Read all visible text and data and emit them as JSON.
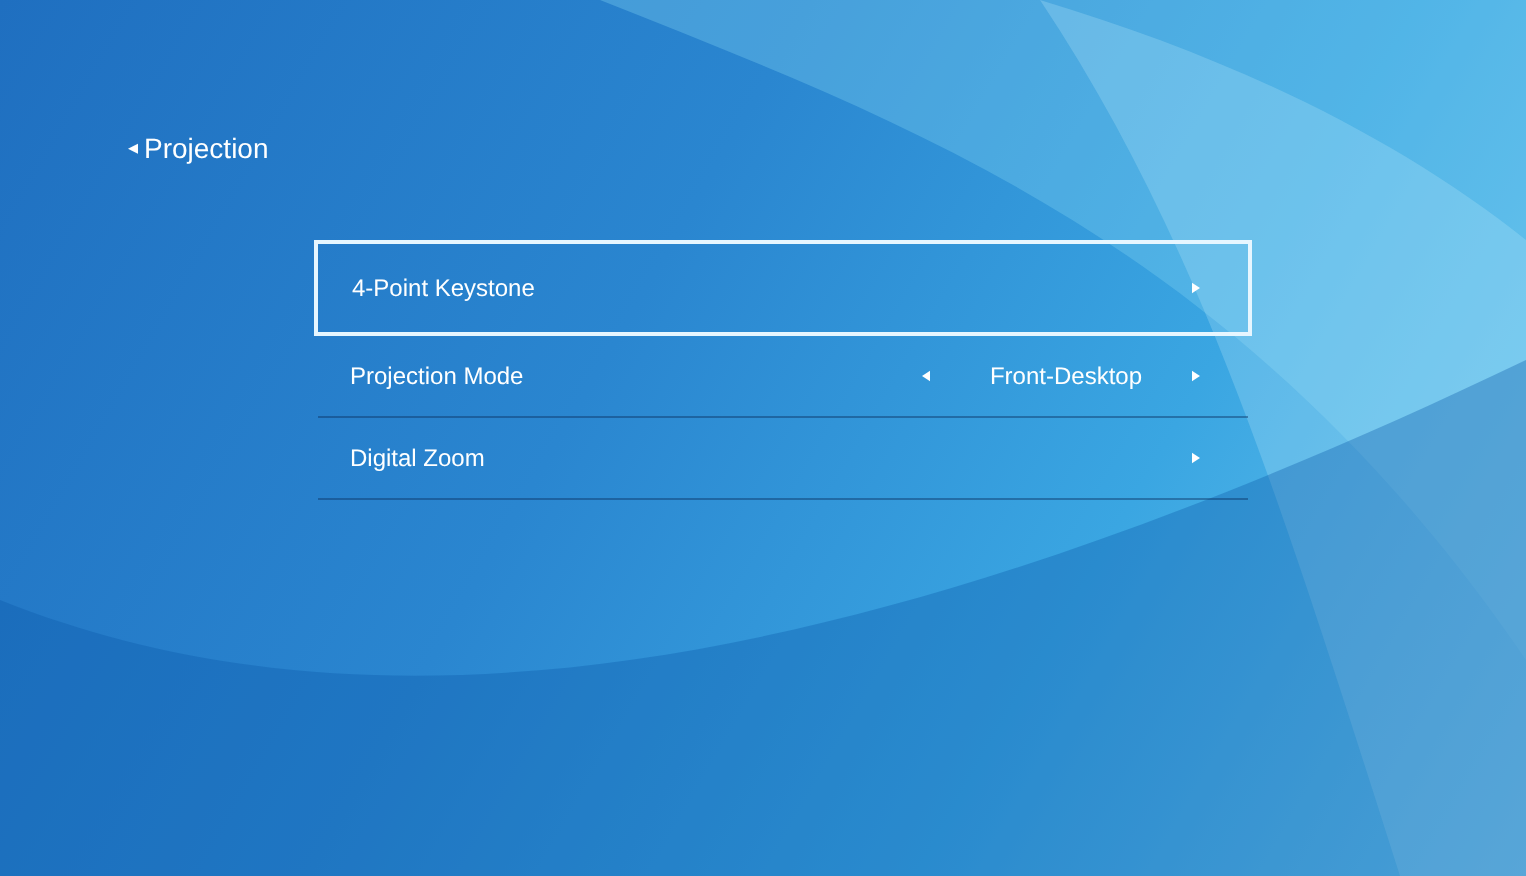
{
  "header": {
    "back_glyph": "◂",
    "title": "Projection"
  },
  "menu": [
    {
      "kind": "link",
      "label": "4-Point Keystone",
      "selected": true
    },
    {
      "kind": "selector",
      "label": "Projection Mode",
      "value": "Front-Desktop",
      "selected": false
    },
    {
      "kind": "link",
      "label": "Digital Zoom",
      "selected": false
    }
  ]
}
